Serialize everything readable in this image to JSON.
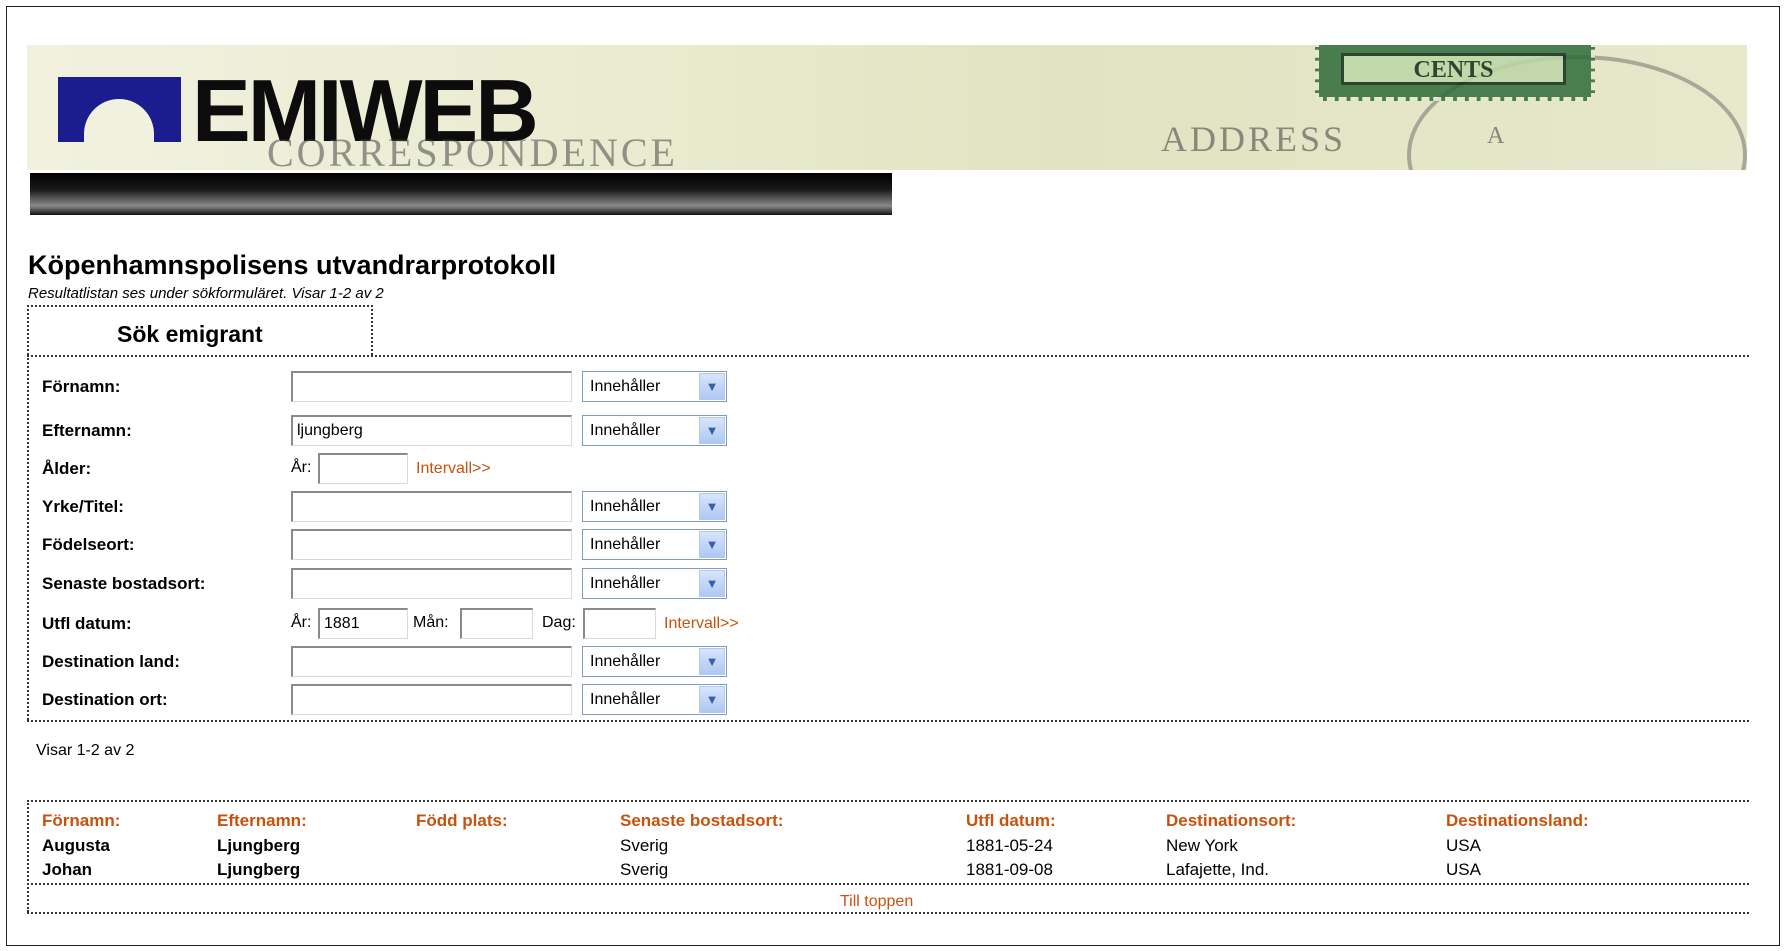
{
  "header": {
    "logo_text": "EMIWEB",
    "logo_subtitle": "CORRESPONDENCE",
    "banner_address": "ADDRESS",
    "stamp_text": "CENTS",
    "postmark_letter": "A"
  },
  "page": {
    "title": "Köpenhamnspolisens utvandrarprotokoll",
    "subtitle": "Resultatlistan ses under sökformuläret. Visar 1-2 av 2"
  },
  "search": {
    "tab_label": "Sök emigrant",
    "fields": {
      "firstname": {
        "label": "Förnamn:",
        "value": "",
        "operator": "Innehåller"
      },
      "lastname": {
        "label": "Efternamn:",
        "value": "ljungberg",
        "operator": "Innehåller"
      },
      "age": {
        "label": "Ålder:",
        "year_label": "År:",
        "year_value": "",
        "interval_link": "Intervall>>"
      },
      "occupation": {
        "label": "Yrke/Titel:",
        "value": "",
        "operator": "Innehåller"
      },
      "birthplace": {
        "label": "Födelseort:",
        "value": "",
        "operator": "Innehåller"
      },
      "last_residence": {
        "label": "Senaste bostadsort:",
        "value": "",
        "operator": "Innehåller"
      },
      "emigration_date": {
        "label": "Utfl datum:",
        "year_label": "År:",
        "year_value": "1881",
        "month_label": "Mån:",
        "month_value": "",
        "day_label": "Dag:",
        "day_value": "",
        "interval_link": "Intervall>>"
      },
      "destination_country": {
        "label": "Destination land:",
        "value": "",
        "operator": "Innehåller"
      },
      "destination_city": {
        "label": "Destination ort:",
        "value": "",
        "operator": "Innehåller"
      }
    }
  },
  "results": {
    "count_text": "Visar 1-2 av 2",
    "columns": [
      "Förnamn:",
      "Efternamn:",
      "Född plats:",
      "Senaste bostadsort:",
      "Utfl datum:",
      "Destinationsort:",
      "Destinationsland:"
    ],
    "rows": [
      [
        "Augusta",
        "Ljungberg",
        "",
        "Sverig",
        "1881-05-24",
        "New York",
        "USA"
      ],
      [
        "Johan",
        "Ljungberg",
        "",
        "Sverig",
        "1881-09-08",
        "Lafajette, Ind.",
        "USA"
      ]
    ],
    "to_top_link": "Till toppen"
  },
  "colors": {
    "accent_orange": "#c8520c",
    "logo_blue": "#1b1d8f",
    "select_arrow": "#aec8f3"
  }
}
